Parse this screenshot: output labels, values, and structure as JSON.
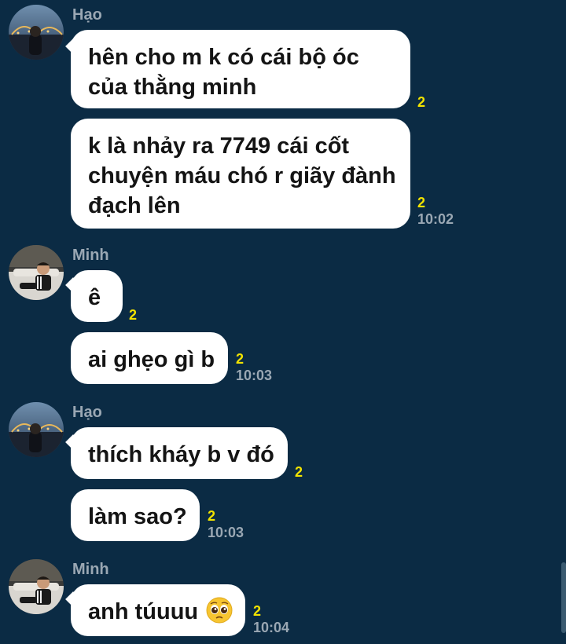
{
  "messages": [
    {
      "sender": "Hạo",
      "avatar": "hao-avatar",
      "bubbles": [
        {
          "lines": [
            "hên cho m k có cái bộ óc",
            "của thằng minh"
          ],
          "seen": "2",
          "time": ""
        },
        {
          "lines": [
            "k là nhảy ra 7749 cái cốt",
            "chuyện máu chó r giãy đành",
            "đạch lên"
          ],
          "seen": "2",
          "time": "10:02"
        }
      ]
    },
    {
      "sender": "Minh",
      "avatar": "minh-avatar",
      "bubbles": [
        {
          "lines": [
            "ê"
          ],
          "seen": "2",
          "time": ""
        },
        {
          "lines": [
            "ai ghẹo gì b"
          ],
          "seen": "2",
          "time": "10:03"
        }
      ]
    },
    {
      "sender": "Hạo",
      "avatar": "hao-avatar",
      "bubbles": [
        {
          "lines": [
            "thích kháy b v đó"
          ],
          "seen": "2",
          "time": ""
        },
        {
          "lines": [
            "làm sao?"
          ],
          "seen": "2",
          "time": "10:03"
        }
      ]
    },
    {
      "sender": "Minh",
      "avatar": "minh-avatar",
      "bubbles": [
        {
          "lines": [
            "anh túuuu"
          ],
          "emoji": "pleading-face-icon",
          "seen": "2",
          "time": "10:04"
        }
      ]
    }
  ],
  "colors": {
    "background": "#0b2b44",
    "bubble": "#ffffff",
    "seen_count": "#f2e300",
    "timestamp": "#9aa7b3"
  }
}
